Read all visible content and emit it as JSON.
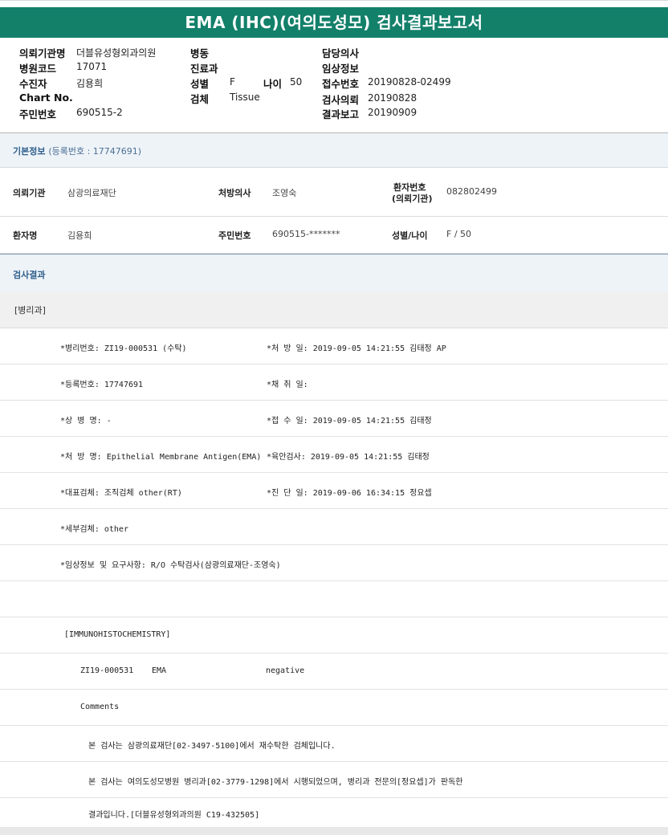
{
  "title": "EMA (IHC)(여의도성모) 검사결과보고서",
  "header": {
    "col1": [
      {
        "label": "의뢰기관명",
        "value": "더블유성형외과의원"
      },
      {
        "label": "병원코드",
        "value": "17071"
      },
      {
        "label": "수진자",
        "value": "김용희"
      },
      {
        "label": "Chart No.",
        "value": ""
      },
      {
        "label": "주민번호",
        "value": "690515-2"
      }
    ],
    "col2": [
      {
        "label": "병동",
        "value": ""
      },
      {
        "label": "진료과",
        "value": ""
      },
      {
        "label": "성별",
        "value": "F"
      },
      {
        "label": "검체",
        "value": "Tissue"
      }
    ],
    "age": {
      "label": "나이",
      "value": "50"
    },
    "col3": [
      {
        "label": "담당의사",
        "value": ""
      },
      {
        "label": "임상정보",
        "value": ""
      },
      {
        "label": "접수번호",
        "value": "20190828-02499"
      },
      {
        "label": "검사의뢰",
        "value": "20190828"
      },
      {
        "label": "결과보고",
        "value": "20190909"
      }
    ]
  },
  "basic_info": {
    "label": "기본정보",
    "reg": "(등록번호 : 17747691)"
  },
  "info_rows": {
    "r1": {
      "k1": "의뢰기관",
      "v1": "삼광의료재단",
      "k2": "처방의사",
      "v2": "조영숙",
      "k3a": "환자번호",
      "k3b": "(의뢰기관)",
      "v3": "082802499"
    },
    "r2": {
      "k1": "환자명",
      "v1": "김용희",
      "k2": "주민번호",
      "v2": "690515-*******",
      "k3": "성별/나이",
      "v3": "F / 50"
    }
  },
  "results": {
    "label": "검사결과",
    "dept": "[병리과]",
    "rows": [
      {
        "a": "*병리번호: ZI19-000531 (수탁)",
        "b": "*처 방 일: 2019-09-05 14:21:55  김태정 AP"
      },
      {
        "a": "*등록번호: 17747691",
        "b": "*채 취 일:"
      },
      {
        "a": "*상 병 명: -",
        "b": "*접 수 일: 2019-09-05 14:21:55  김태정"
      },
      {
        "a": "*처 방 명: Epithelial Membrane Antigen(EMA)",
        "b": "*육안검사: 2019-09-05 14:21:55  김태정"
      },
      {
        "a": "*대표검체: 조직검체 other(RT)",
        "b": "*진 단 일: 2019-09-06 16:34:15  정요셉"
      },
      {
        "a": "*세부검체: other",
        "b": ""
      },
      {
        "a": "*임상정보 및 요구사항: R/O 수탁검사(삼광의료재단-조영숙)",
        "b": ""
      }
    ],
    "ihc_header": "[IMMUNOHISTOCHEMISTRY]",
    "ihc_row": {
      "id": "ZI19-000531",
      "marker": "EMA",
      "result": "negative"
    },
    "comments_label": "Comments",
    "comment1": "본 검사는 삼광의료재단[02-3497-5100]에서 재수탁한 검체입니다.",
    "comment2": "본 검사는 여의도성모병원 병리과[02-3779-1298]에서 시행되었으며, 병리과 전문의[정요셉]가 판독한",
    "comment3": "결과입니다.[더블유성형외과의원 C19-432505]"
  }
}
